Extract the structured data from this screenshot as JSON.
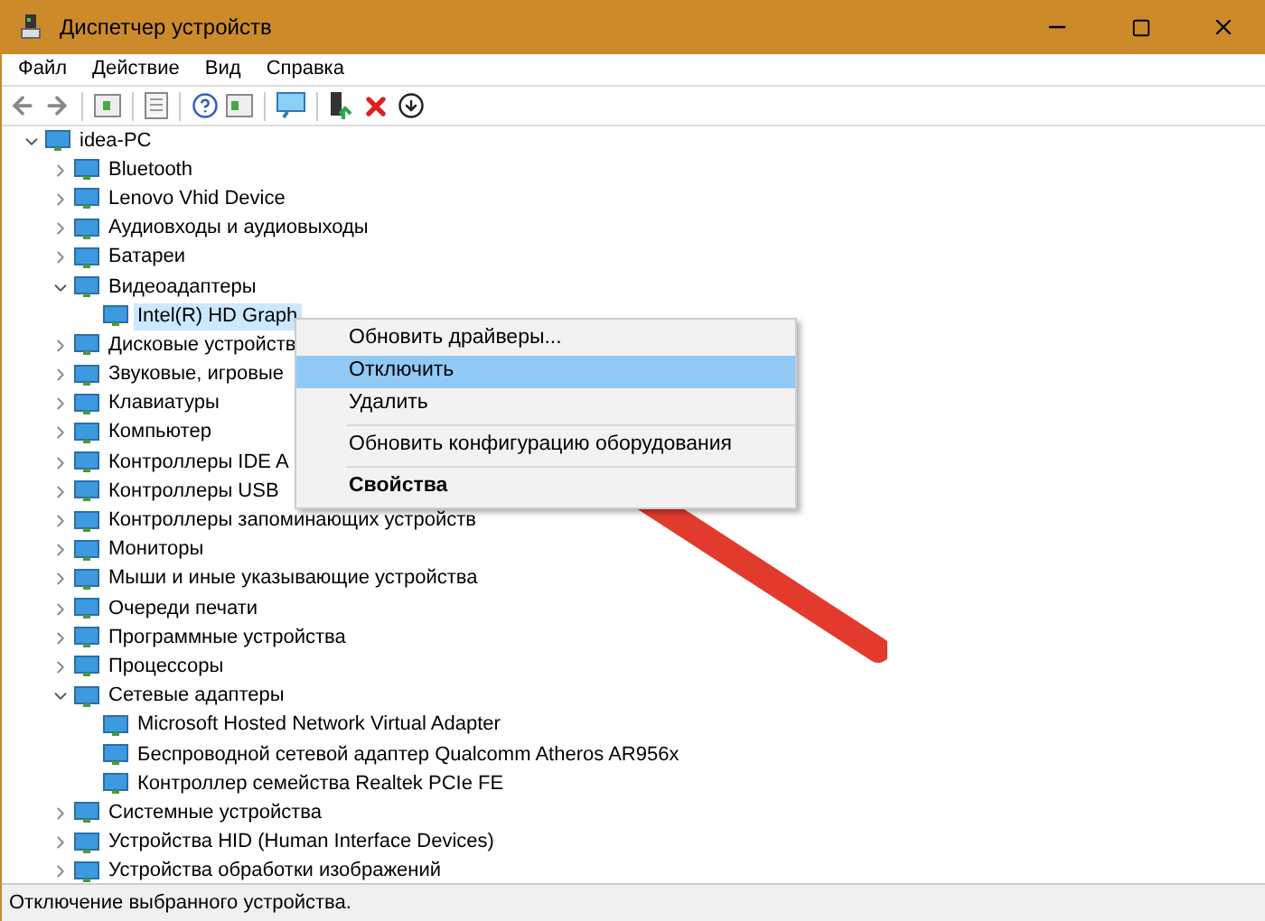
{
  "window": {
    "title": "Диспетчер устройств"
  },
  "menu_bar": [
    "Файл",
    "Действие",
    "Вид",
    "Справка"
  ],
  "tree": [
    {
      "label": "idea-PC",
      "expanded": true,
      "selected": false,
      "children": [
        {
          "label": "Bluetooth",
          "expanded": false,
          "selected": false
        },
        {
          "label": "Lenovo Vhid Device",
          "expanded": false,
          "selected": false
        },
        {
          "label": "Аудиовходы и аудиовыходы",
          "expanded": false,
          "selected": false
        },
        {
          "label": "Батареи",
          "expanded": false,
          "selected": false
        },
        {
          "label": "Видеоадаптеры",
          "expanded": true,
          "selected": false,
          "children": [
            {
              "label": "Intel(R) HD Graph",
              "selected": true
            }
          ]
        },
        {
          "label": "Дисковые устройств",
          "expanded": false,
          "selected": false
        },
        {
          "label": "Звуковые, игровые",
          "expanded": false,
          "selected": false
        },
        {
          "label": "Клавиатуры",
          "expanded": false,
          "selected": false
        },
        {
          "label": "Компьютер",
          "expanded": false,
          "selected": false
        },
        {
          "label": "Контроллеры IDE A",
          "expanded": false,
          "selected": false
        },
        {
          "label": "Контроллеры USB",
          "expanded": false,
          "selected": false
        },
        {
          "label": "Контроллеры запоминающих устройств",
          "expanded": false,
          "selected": false
        },
        {
          "label": "Мониторы",
          "expanded": false,
          "selected": false
        },
        {
          "label": "Мыши и иные указывающие устройства",
          "expanded": false,
          "selected": false
        },
        {
          "label": "Очереди печати",
          "expanded": false,
          "selected": false
        },
        {
          "label": "Программные устройства",
          "expanded": false,
          "selected": false
        },
        {
          "label": "Процессоры",
          "expanded": false,
          "selected": false
        },
        {
          "label": "Сетевые адаптеры",
          "expanded": true,
          "selected": false,
          "children": [
            {
              "label": "Microsoft Hosted Network Virtual Adapter",
              "selected": false
            },
            {
              "label": "Беспроводной сетевой адаптер Qualcomm Atheros AR956x",
              "selected": false
            },
            {
              "label": "Контроллер семейства Realtek PCIe FE",
              "selected": false
            }
          ]
        },
        {
          "label": "Системные устройства",
          "expanded": false,
          "selected": false
        },
        {
          "label": "Устройства HID (Human Interface Devices)",
          "expanded": false,
          "selected": false
        },
        {
          "label": "Устройства обработки изображений",
          "expanded": false,
          "selected": false
        }
      ]
    }
  ],
  "context_menu": [
    {
      "kind": "item",
      "label": "Обновить драйверы...",
      "selected": false,
      "bold": false
    },
    {
      "kind": "item",
      "label": "Отключить",
      "selected": true,
      "bold": false
    },
    {
      "kind": "item",
      "label": "Удалить",
      "selected": false,
      "bold": false
    },
    {
      "kind": "separator"
    },
    {
      "kind": "item",
      "label": "Обновить конфигурацию оборудования",
      "selected": false,
      "bold": false
    },
    {
      "kind": "separator"
    },
    {
      "kind": "item",
      "label": "Свойства",
      "selected": false,
      "bold": true
    }
  ],
  "status_bar": "Отключение выбранного устройства."
}
